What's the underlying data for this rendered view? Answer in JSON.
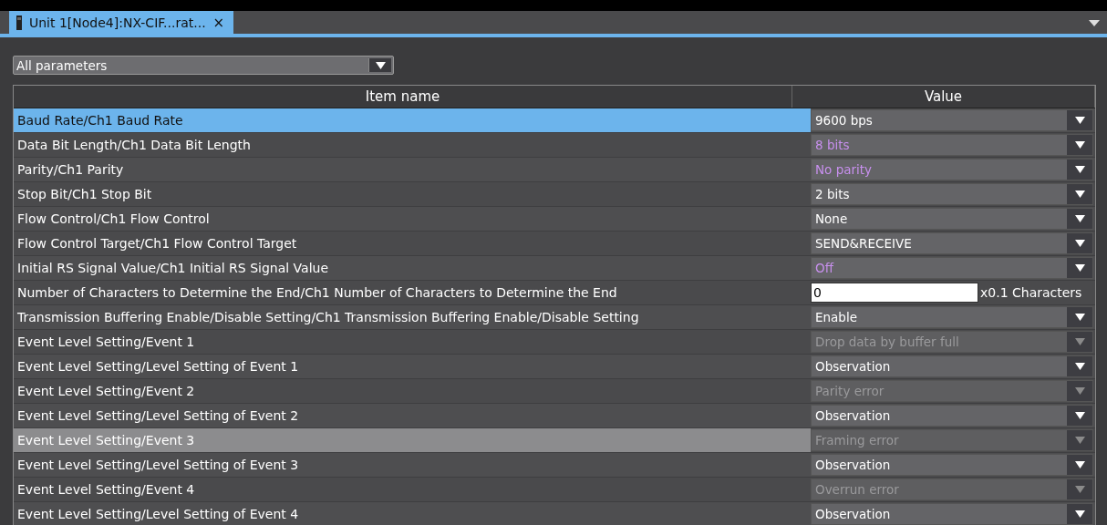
{
  "tab": {
    "title": "Unit 1[Node4]:NX-CIF...rat...",
    "close": "×",
    "selected": true
  },
  "filter": {
    "value": "All parameters"
  },
  "table": {
    "columns": [
      "Item name",
      "Value"
    ],
    "rows": [
      {
        "name": "Baud Rate/Ch1 Baud Rate",
        "kind": "dropdown",
        "value": "9600 bps",
        "selected": true,
        "hovered": false,
        "modified": false,
        "disabled": false
      },
      {
        "name": "Data Bit Length/Ch1 Data Bit Length",
        "kind": "dropdown",
        "value": "8 bits",
        "selected": false,
        "hovered": false,
        "modified": true,
        "disabled": false
      },
      {
        "name": "Parity/Ch1 Parity",
        "kind": "dropdown",
        "value": "No parity",
        "selected": false,
        "hovered": false,
        "modified": true,
        "disabled": false
      },
      {
        "name": "Stop Bit/Ch1 Stop Bit",
        "kind": "dropdown",
        "value": "2 bits",
        "selected": false,
        "hovered": false,
        "modified": false,
        "disabled": false
      },
      {
        "name": "Flow Control/Ch1 Flow Control",
        "kind": "dropdown",
        "value": "None",
        "selected": false,
        "hovered": false,
        "modified": false,
        "disabled": false
      },
      {
        "name": "Flow Control Target/Ch1 Flow Control Target",
        "kind": "dropdown",
        "value": "SEND&RECEIVE",
        "selected": false,
        "hovered": false,
        "modified": false,
        "disabled": false
      },
      {
        "name": "Initial RS Signal Value/Ch1 Initial RS Signal Value",
        "kind": "dropdown",
        "value": "Off",
        "selected": false,
        "hovered": false,
        "modified": true,
        "disabled": false
      },
      {
        "name": "Number of Characters to Determine the End/Ch1 Number of Characters to Determine the End",
        "kind": "input",
        "value": "0",
        "unit": "x0.1 Characters",
        "selected": false,
        "hovered": false,
        "modified": false,
        "disabled": false
      },
      {
        "name": "Transmission Buffering Enable/Disable Setting/Ch1 Transmission Buffering Enable/Disable Setting",
        "kind": "dropdown",
        "value": "Enable",
        "selected": false,
        "hovered": false,
        "modified": false,
        "disabled": false
      },
      {
        "name": "Event Level Setting/Event 1",
        "kind": "dropdown",
        "value": "Drop data by buffer full",
        "selected": false,
        "hovered": false,
        "modified": false,
        "disabled": true
      },
      {
        "name": "Event Level Setting/Level Setting of Event 1",
        "kind": "dropdown",
        "value": "Observation",
        "selected": false,
        "hovered": false,
        "modified": false,
        "disabled": false
      },
      {
        "name": "Event Level Setting/Event 2",
        "kind": "dropdown",
        "value": "Parity error",
        "selected": false,
        "hovered": false,
        "modified": false,
        "disabled": true
      },
      {
        "name": "Event Level Setting/Level Setting of Event 2",
        "kind": "dropdown",
        "value": "Observation",
        "selected": false,
        "hovered": false,
        "modified": false,
        "disabled": false
      },
      {
        "name": "Event Level Setting/Event 3",
        "kind": "dropdown",
        "value": "Framing error",
        "selected": false,
        "hovered": true,
        "modified": false,
        "disabled": true
      },
      {
        "name": "Event Level Setting/Level Setting of Event 3",
        "kind": "dropdown",
        "value": "Observation",
        "selected": false,
        "hovered": false,
        "modified": false,
        "disabled": false
      },
      {
        "name": "Event Level Setting/Event 4",
        "kind": "dropdown",
        "value": "Overrun error",
        "selected": false,
        "hovered": false,
        "modified": false,
        "disabled": true
      },
      {
        "name": "Event Level Setting/Level Setting of Event 4",
        "kind": "dropdown",
        "value": "Observation",
        "selected": false,
        "hovered": false,
        "modified": false,
        "disabled": false
      }
    ]
  }
}
